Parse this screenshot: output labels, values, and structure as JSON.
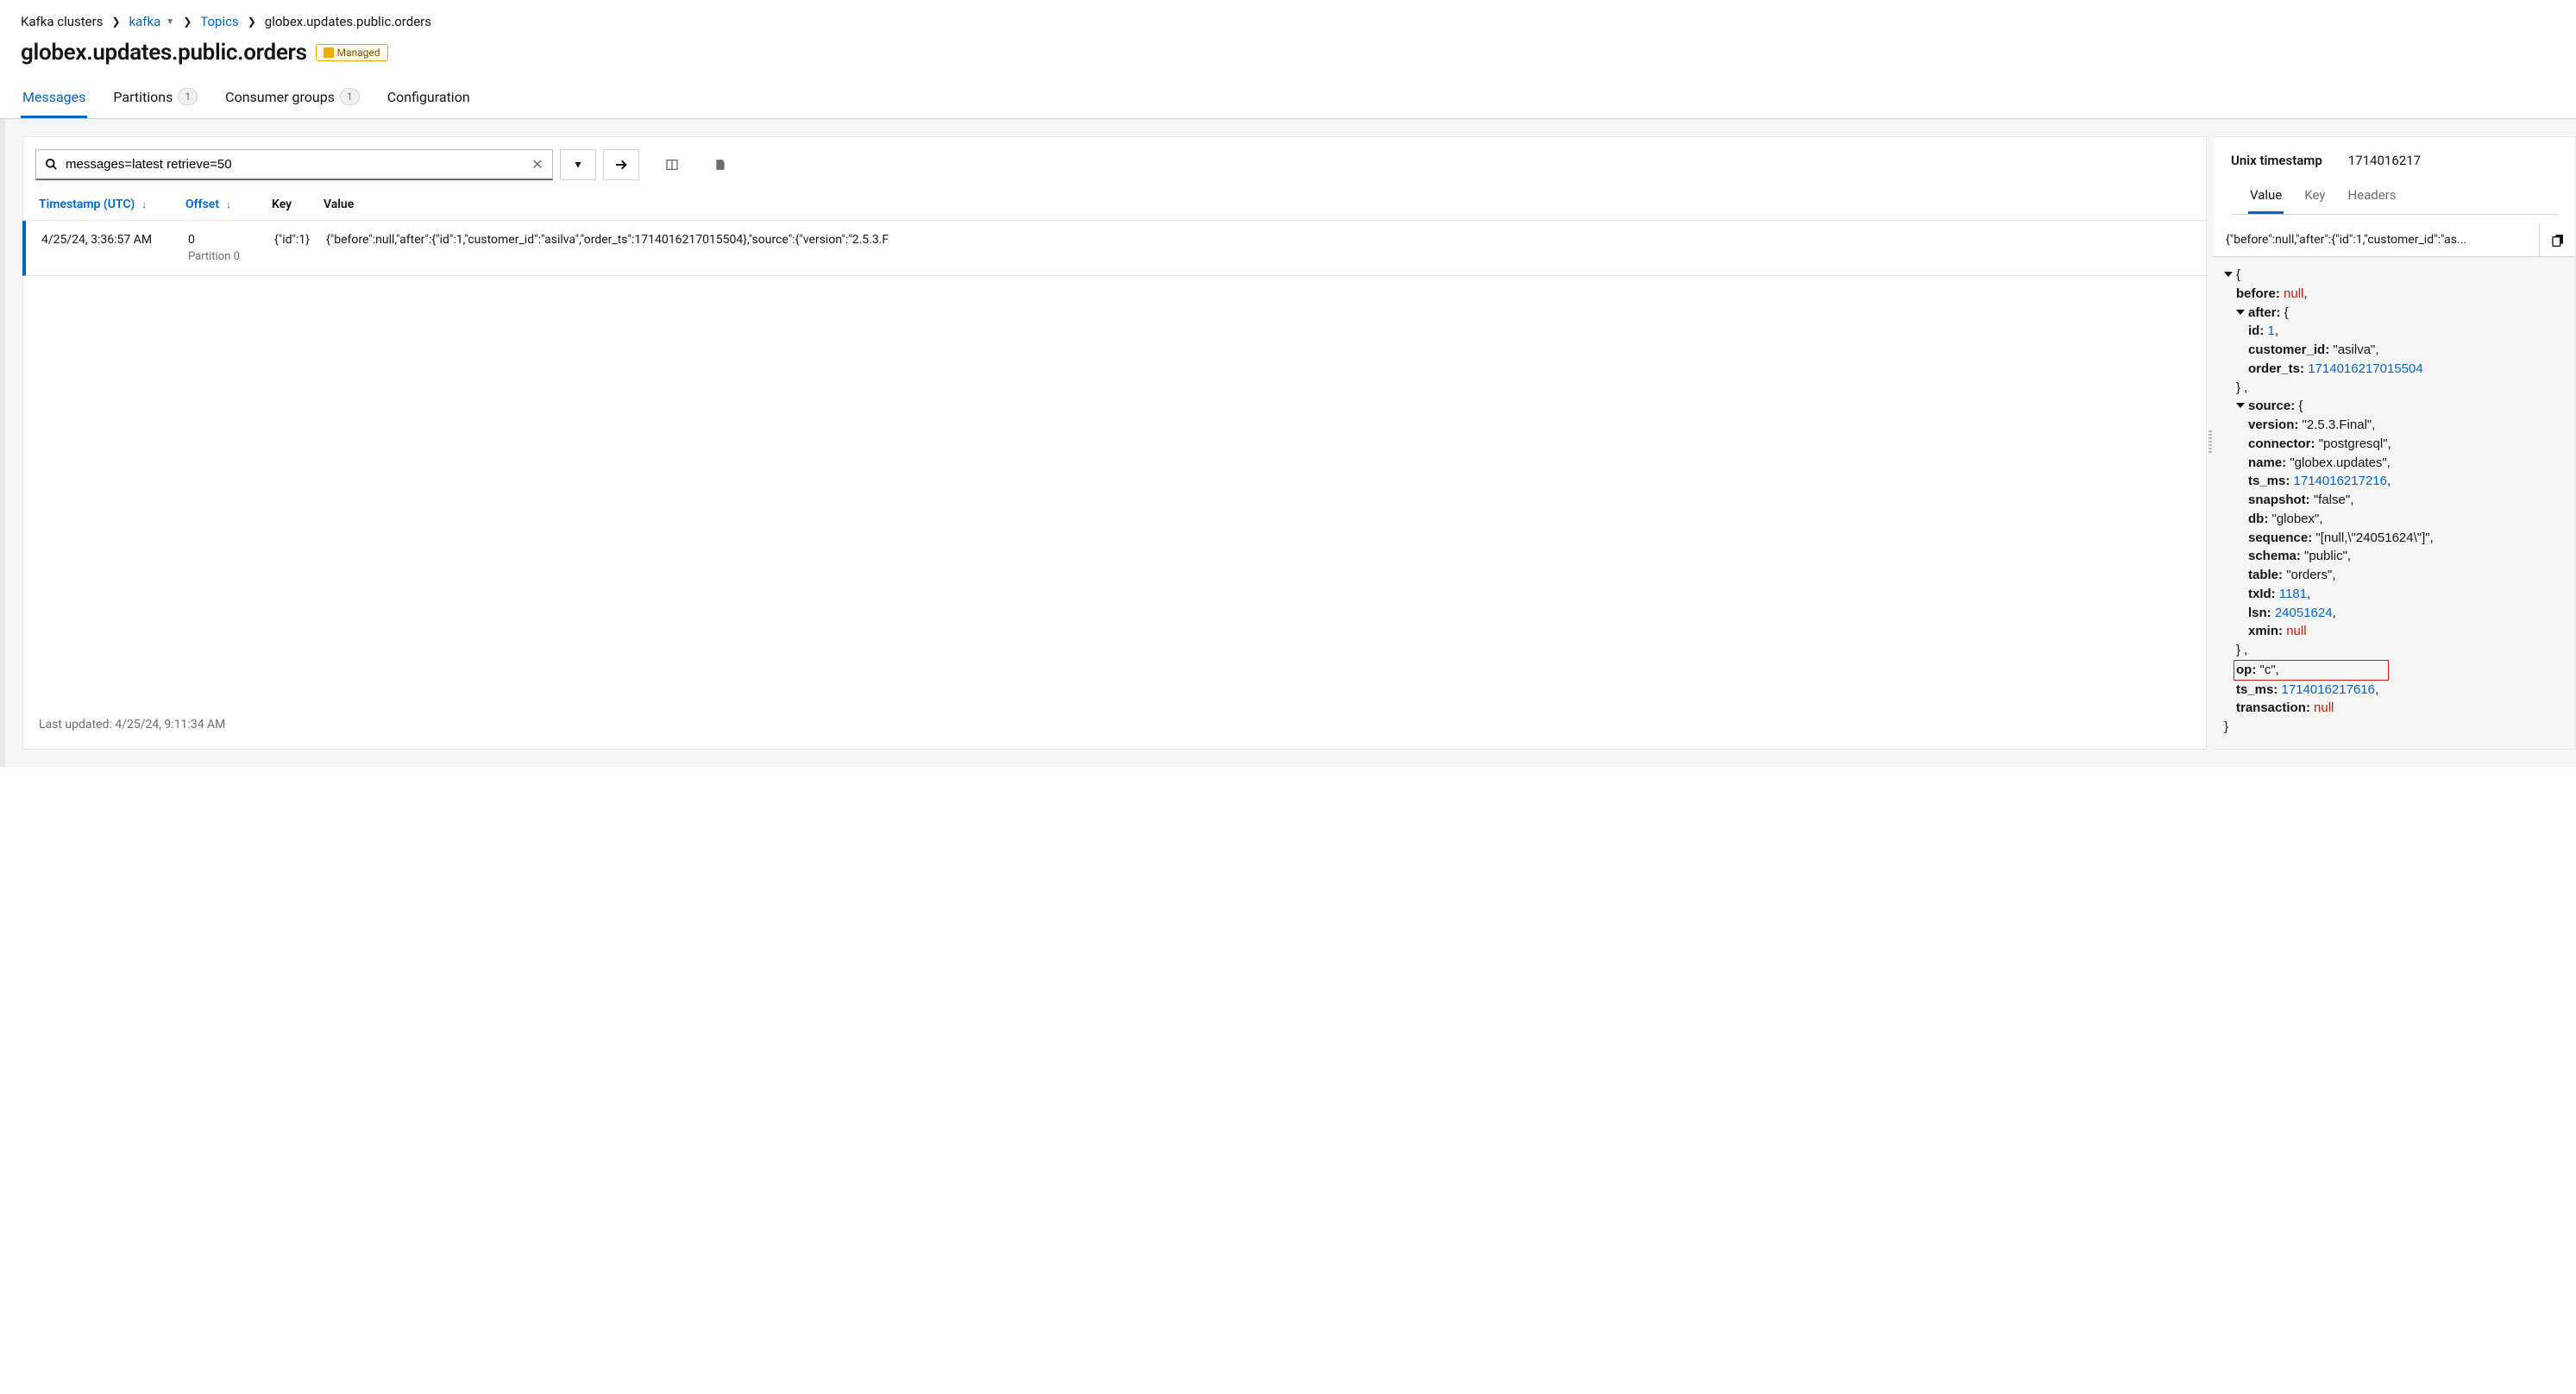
{
  "breadcrumb": {
    "root": "Kafka clusters",
    "cluster": "kafka",
    "section": "Topics",
    "current": "globex.updates.public.orders"
  },
  "title": "globex.updates.public.orders",
  "badge": {
    "label": "Managed"
  },
  "main_tabs": {
    "messages": "Messages",
    "partitions": "Partitions",
    "partitions_count": "1",
    "consumer_groups": "Consumer groups",
    "consumer_groups_count": "1",
    "configuration": "Configuration"
  },
  "search": {
    "value": "messages=latest retrieve=50"
  },
  "columns": {
    "timestamp": "Timestamp (UTC)",
    "offset": "Offset",
    "key": "Key",
    "value": "Value"
  },
  "row": {
    "timestamp": "4/25/24, 3:36:57 AM",
    "offset": "0",
    "partition": "Partition 0",
    "key": "{\"id\":1}",
    "value": "{\"before\":null,\"after\":{\"id\":1,\"customer_id\":\"asilva\",\"order_ts\":1714016217015504},\"source\":{\"version\":\"2.5.3.F"
  },
  "last_updated_label": "Last updated:",
  "last_updated_value": "4/25/24, 9:11:34 AM",
  "detail": {
    "unix_label": "Unix timestamp",
    "unix_value": "1714016217",
    "tabs": {
      "value": "Value",
      "key": "Key",
      "headers": "Headers"
    },
    "summary": "{\"before\":null,\"after\":{\"id\":1,\"customer_id\":\"as...",
    "json": {
      "before_k": "before:",
      "before_v": "null",
      "after_k": "after:",
      "after_id_k": "id:",
      "after_id_v": "1",
      "after_cust_k": "customer_id:",
      "after_cust_v": "\"asilva\"",
      "after_ots_k": "order_ts:",
      "after_ots_v": "1714016217015504",
      "source_k": "source:",
      "src_version_k": "version:",
      "src_version_v": "\"2.5.3.Final\"",
      "src_connector_k": "connector:",
      "src_connector_v": "\"postgresql\"",
      "src_name_k": "name:",
      "src_name_v": "\"globex.updates\"",
      "src_tsms_k": "ts_ms:",
      "src_tsms_v": "1714016217216",
      "src_snapshot_k": "snapshot:",
      "src_snapshot_v": "\"false\"",
      "src_db_k": "db:",
      "src_db_v": "\"globex\"",
      "src_sequence_k": "sequence:",
      "src_sequence_v": "\"[null,\\\"24051624\\\"]\"",
      "src_schema_k": "schema:",
      "src_schema_v": "\"public\"",
      "src_table_k": "table:",
      "src_table_v": "\"orders\"",
      "src_txid_k": "txId:",
      "src_txid_v": "1181",
      "src_lsn_k": "lsn:",
      "src_lsn_v": "24051624",
      "src_xmin_k": "xmin:",
      "src_xmin_v": "null",
      "op_k": "op:",
      "op_v": "\"c\"",
      "tsms_k": "ts_ms:",
      "tsms_v": "1714016217616",
      "txn_k": "transaction:",
      "txn_v": "null"
    }
  }
}
